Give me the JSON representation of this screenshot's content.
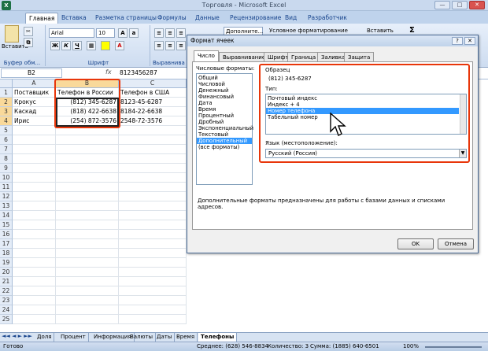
{
  "app": {
    "title": "Торговля - Microsoft Excel"
  },
  "window_controls": {
    "minimize": "—",
    "maximize": "□",
    "close": "✕"
  },
  "ribbon": {
    "tabs": [
      "Главная",
      "Вставка",
      "Разметка страницы",
      "Формулы",
      "Данные",
      "Рецензирование",
      "Вид",
      "Разработчик"
    ],
    "active_tab": 0,
    "clipboard": {
      "paste_label": "Вставить",
      "group_label": "Буфер обм..."
    },
    "font": {
      "name": "Arial",
      "size": "10",
      "bold": "Ж",
      "italic": "К",
      "underline": "Ч",
      "group_label": "Шрифт"
    },
    "alignment": {
      "group_label": "Выравнива"
    },
    "number": {
      "format_value": "Дополните..."
    },
    "styles": {
      "conditional_label": "Условное форматирование"
    },
    "cells": {
      "insert_label": "Вставить"
    },
    "editing": {
      "sum_symbol": "Σ"
    }
  },
  "formula_bar": {
    "name_box": "B2",
    "fx": "fx",
    "value": "8123456287"
  },
  "sheet": {
    "columns": [
      "A",
      "B",
      "C"
    ],
    "rows": [
      [
        "Поставщик",
        "Телефон в России",
        "Телефон в США"
      ],
      [
        "Крокус",
        "(812) 345-6287",
        "8123-45-6287"
      ],
      [
        "Каскад",
        "(818) 422-6638",
        "8184-22-6638"
      ],
      [
        "Ирис",
        "(254) 872-3576",
        "2548-72-3576"
      ]
    ],
    "row_numbers": [
      "1",
      "2",
      "3",
      "4",
      "5",
      "6",
      "7",
      "8",
      "9",
      "10",
      "11",
      "12",
      "13",
      "14",
      "15",
      "16",
      "17",
      "18",
      "19",
      "20",
      "21",
      "22",
      "23",
      "24",
      "25"
    ]
  },
  "sheet_tabs": [
    "Доля",
    "Процент",
    "Информация",
    "Валюты",
    "Даты",
    "Время",
    "Телефоны"
  ],
  "active_sheet": 6,
  "status_bar": {
    "ready": "Готово",
    "average": "Среднее: (628) 546-8834",
    "count": "Количество: 3",
    "sum": "Сумма: (1885) 640-6501",
    "zoom": "100%"
  },
  "dialog": {
    "title": "Формат ячеек",
    "help": "?",
    "close": "✕",
    "tabs": [
      "Число",
      "Выравнивание",
      "Шрифт",
      "Граница",
      "Заливка",
      "Защита"
    ],
    "active_tab": 0,
    "number_formats_label": "Числовые форматы:",
    "formats": [
      "Общий",
      "Числовой",
      "Денежный",
      "Финансовый",
      "Дата",
      "Время",
      "Процентный",
      "Дробный",
      "Экспоненциальный",
      "Текстовый",
      "Дополнительный",
      "(все форматы)"
    ],
    "selected_format": 10,
    "sample_label": "Образец",
    "sample_value": "(812) 345-6287",
    "type_label": "Тип:",
    "types": [
      "Почтовый индекс",
      "Индекс + 4",
      "Номер телефона",
      "Табельный номер"
    ],
    "selected_type": 2,
    "locale_label": "Язык (местоположение):",
    "locale_value": "Русский (Россия)",
    "description": "Дополнительные форматы предназначены для работы с базами данных и списками адресов.",
    "ok": "OK",
    "cancel": "Отмена"
  },
  "colors": {
    "highlight": "#e8360a",
    "selection": "#3399ff",
    "ribbon": "#cddcf0"
  }
}
